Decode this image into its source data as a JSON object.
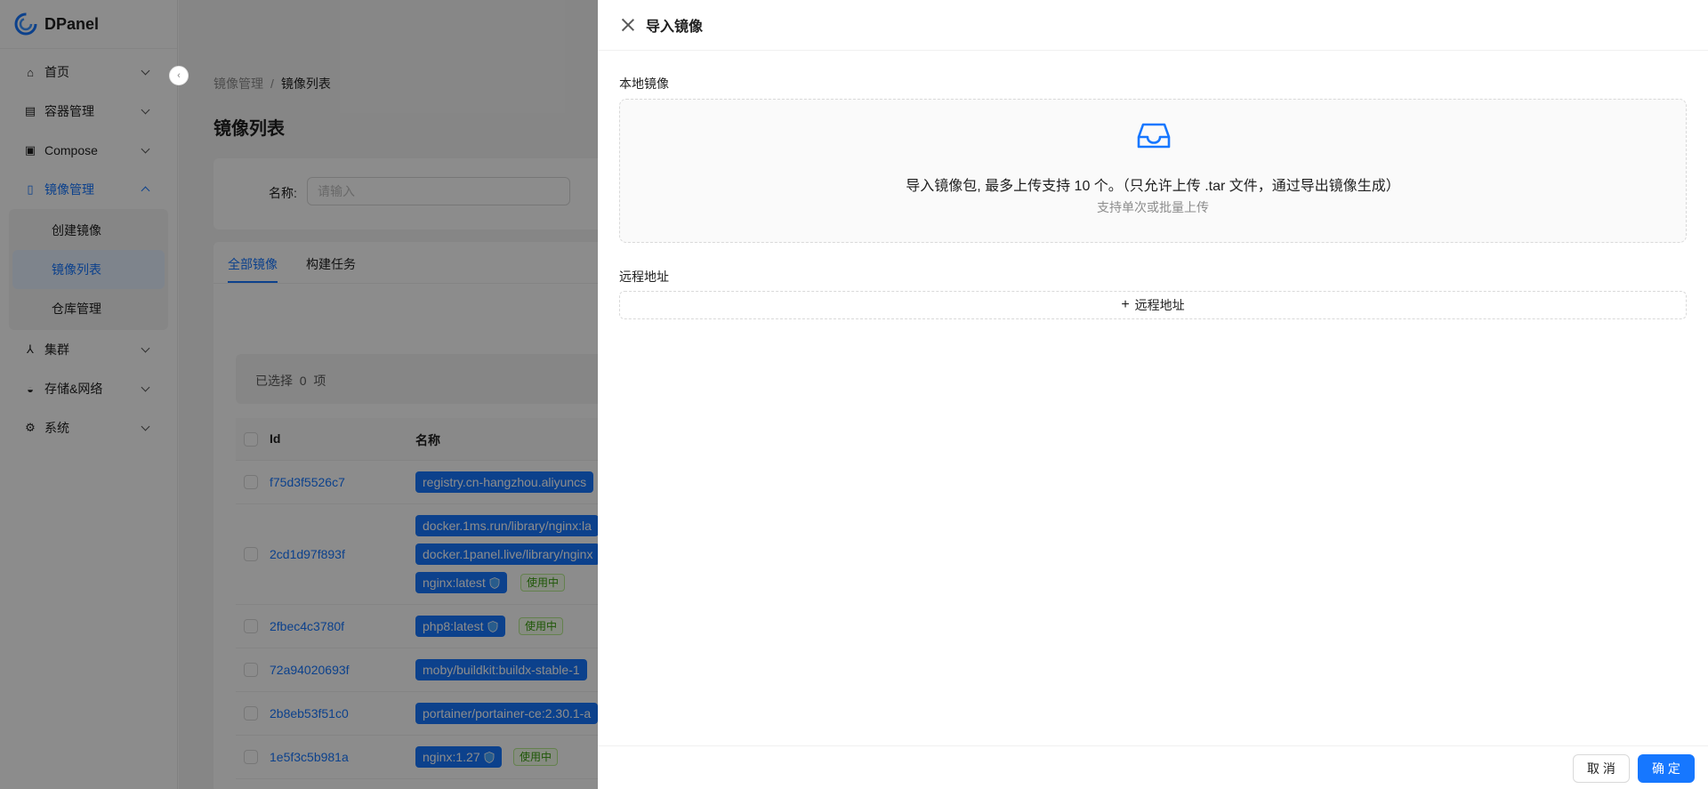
{
  "app": {
    "name": "DPanel",
    "accent": "#1677ff"
  },
  "sidebar": {
    "items": [
      {
        "label": "首页",
        "icon": "home-icon"
      },
      {
        "label": "容器管理",
        "icon": "container-icon"
      },
      {
        "label": "Compose",
        "icon": "compose-icon"
      },
      {
        "label": "镜像管理",
        "icon": "file-icon",
        "open": true,
        "children": [
          {
            "label": "创建镜像"
          },
          {
            "label": "镜像列表",
            "active": true
          },
          {
            "label": "仓库管理"
          }
        ]
      },
      {
        "label": "集群",
        "icon": "cluster-icon"
      },
      {
        "label": "存储&网络",
        "icon": "docker-icon"
      },
      {
        "label": "系统",
        "icon": "gear-icon"
      }
    ]
  },
  "breadcrumb": {
    "parent": "镜像管理",
    "separator": "/",
    "current": "镜像列表"
  },
  "page": {
    "title": "镜像列表"
  },
  "search": {
    "label": "名称:",
    "placeholder": "请输入"
  },
  "tabs": [
    {
      "label": "全部镜像",
      "active": true
    },
    {
      "label": "构建任务"
    }
  ],
  "selection": {
    "text": "已选择",
    "count": "0",
    "unit": "项"
  },
  "table": {
    "columns": {
      "id": "Id",
      "name": "名称"
    },
    "rows": [
      {
        "id": "f75d3f5526c7",
        "tags": [
          {
            "name": "registry.cn-hangzhou.aliyuncs"
          }
        ]
      },
      {
        "id": "2cd1d97f893f",
        "tags": [
          {
            "name": "docker.1ms.run/library/nginx:la"
          },
          {
            "name": "docker.1panel.live/library/nginx"
          },
          {
            "name": "nginx:latest",
            "shield": true,
            "in_use": "使用中"
          }
        ]
      },
      {
        "id": "2fbec4c3780f",
        "tags": [
          {
            "name": "php8:latest",
            "shield": true,
            "in_use": "使用中"
          }
        ]
      },
      {
        "id": "72a94020693f",
        "tags": [
          {
            "name": "moby/buildkit:buildx-stable-1"
          }
        ]
      },
      {
        "id": "2b8eb53f51c0",
        "tags": [
          {
            "name": "portainer/portainer-ce:2.30.1-a"
          }
        ]
      },
      {
        "id": "1e5f3c5b981a",
        "tags": [
          {
            "name": "nginx:1.27",
            "shield": true,
            "in_use": "使用中"
          }
        ]
      }
    ]
  },
  "drawer": {
    "title": "导入镜像",
    "local_label": "本地镜像",
    "upload_text": "导入镜像包, 最多上传支持 10 个。（只允许上传 .tar 文件，通过导出镜像生成）",
    "upload_hint": "支持单次或批量上传",
    "remote_label": "远程地址",
    "remote_button": "远程地址",
    "cancel": "取 消",
    "ok": "确 定"
  }
}
